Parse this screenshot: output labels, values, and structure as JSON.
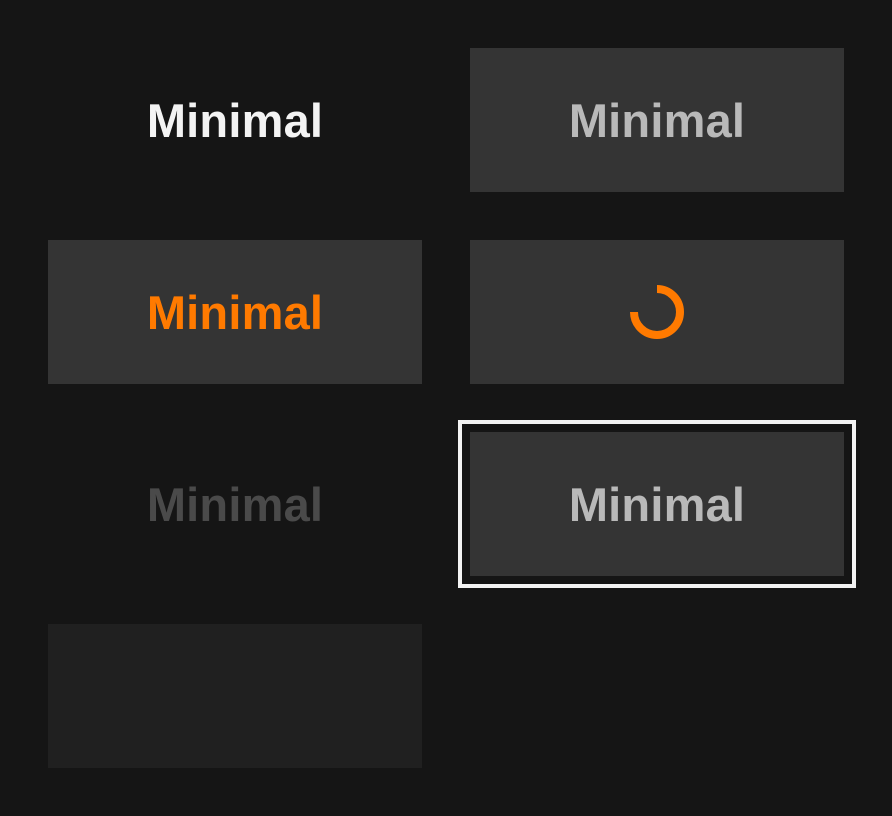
{
  "buttons": {
    "default": {
      "label": "Minimal"
    },
    "hover": {
      "label": "Minimal"
    },
    "active": {
      "label": "Minimal"
    },
    "loading": {
      "icon": "loading-spinner-icon"
    },
    "disabled": {
      "label": "Minimal"
    },
    "focused": {
      "label": "Minimal"
    },
    "empty": {
      "label": ""
    }
  },
  "colors": {
    "background": "#151515",
    "button_surface": "#343434",
    "button_surface_muted": "#202020",
    "text_primary": "#f3f3f3",
    "text_secondary": "#b9b9b9",
    "text_disabled": "#4a4a4a",
    "accent": "#ff7a00",
    "focus_ring": "#f3f3f3"
  }
}
